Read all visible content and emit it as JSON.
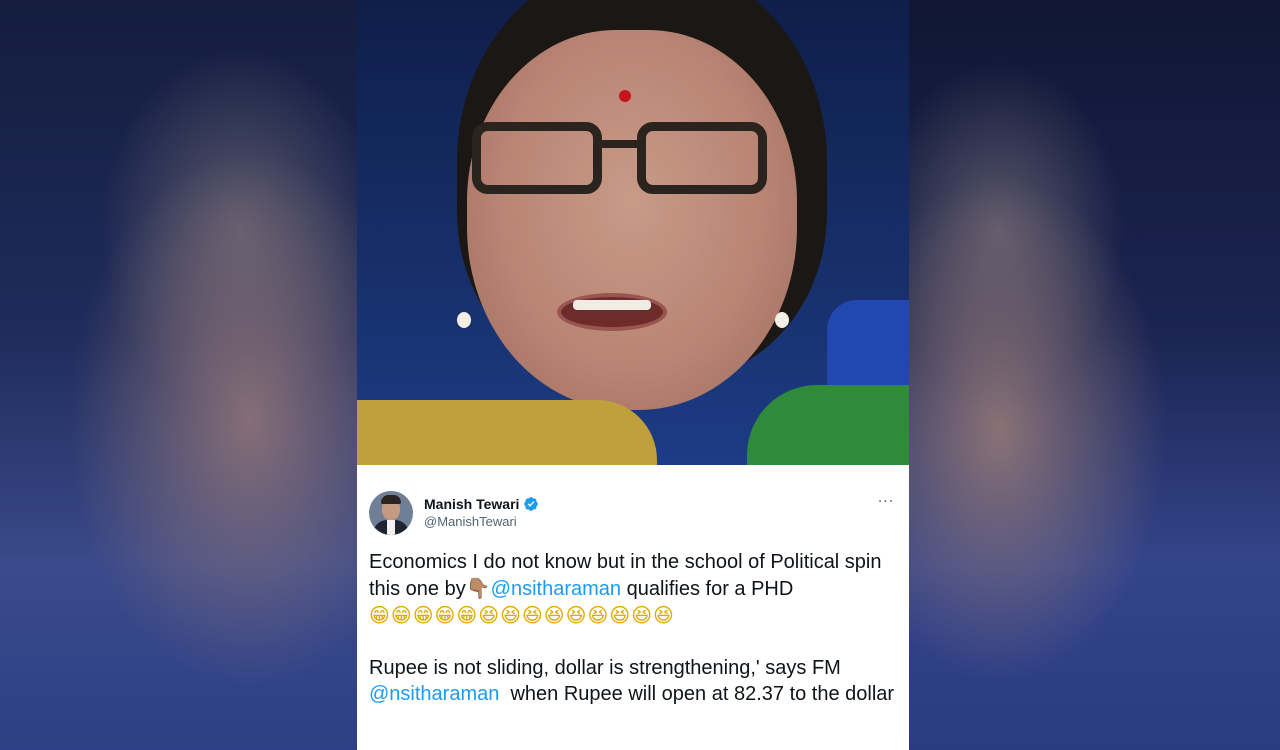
{
  "tweet": {
    "display_name": "Manish Tewari",
    "handle": "@ManishTewari",
    "more_label": "···",
    "para1_text_a": "Economics I do not know but in the school of Political spin this one by",
    "pointing_emoji": "👇🏽",
    "mention_1": "@nsitharaman",
    "para1_text_b": " qualifies for a PHD",
    "emojis": "😁😁😁😁😁😆😆😆😆😆😆😆😆😆",
    "para2_text_a": "Rupee is not sliding, dollar is strengthening,' says FM",
    "mention_2": "@nsitharaman",
    "para2_text_b": "  when Rupee will open at 82.37 to the dollar"
  },
  "colors": {
    "link": "#1d9bf0",
    "text": "#0f1419",
    "muted": "#536471",
    "verified": "#1d9bf0"
  },
  "icons": {
    "verified": "verified-badge-icon",
    "more": "more-options-icon"
  }
}
